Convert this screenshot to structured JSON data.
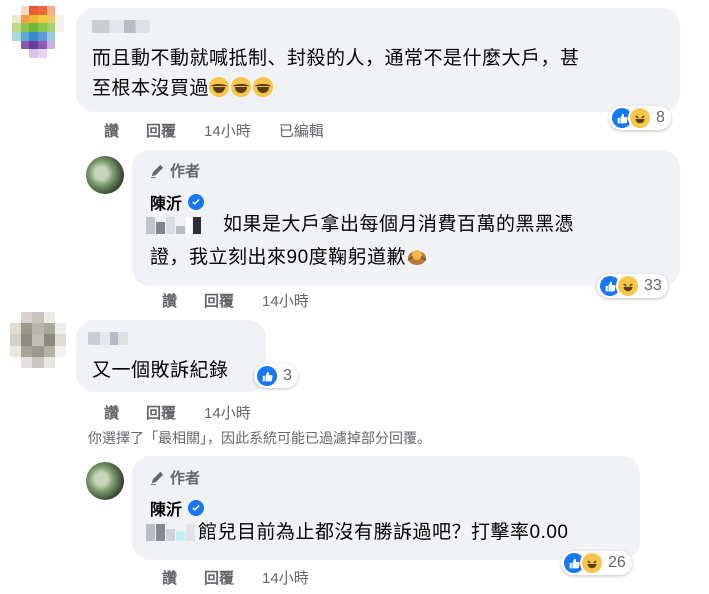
{
  "comments": [
    {
      "text_line1": "而且動不動就喊抵制、封殺的人，通常不是什麼大戶，甚",
      "text_line2": "至根本沒買過",
      "emoji": "haha-crying x3",
      "actions": {
        "like": "讚",
        "reply": "回覆",
        "time": "14小時",
        "edited": "已編輯"
      },
      "reactions": {
        "count": "8",
        "icons": [
          "like-icon",
          "haha-icon"
        ]
      }
    },
    {
      "author_badge": "作者",
      "name": "陳沂",
      "text_line1": "如果是大戶拿出每個月消費百萬的黑黑憑",
      "text_line2": "證，我立刻出來90度鞠躬道歉",
      "actions": {
        "like": "讚",
        "reply": "回覆",
        "time": "14小時"
      },
      "reactions": {
        "count": "33",
        "icons": [
          "like-icon",
          "haha-icon"
        ]
      }
    },
    {
      "text_line1": "又一個敗訴紀錄",
      "actions": {
        "like": "讚",
        "reply": "回覆",
        "time": "14小時"
      },
      "reactions": {
        "count": "3",
        "icons": [
          "like-icon"
        ]
      }
    },
    {
      "author_badge": "作者",
      "name": "陳沂",
      "text_line1": "館兒目前為止都沒有勝訴過吧？打擊率0.00",
      "actions": {
        "like": "讚",
        "reply": "回覆",
        "time": "14小時"
      },
      "reactions": {
        "count": "26",
        "icons": [
          "like-icon",
          "haha-icon"
        ]
      }
    }
  ],
  "notice": "你選擇了「最相關」，因此系統可能已過濾掉部分回覆。",
  "colors": {
    "bubble": "#f0f2f5",
    "secondary_text": "#65676b",
    "like_blue": "#1877f2",
    "haha_yellow": "#f7c64a"
  }
}
